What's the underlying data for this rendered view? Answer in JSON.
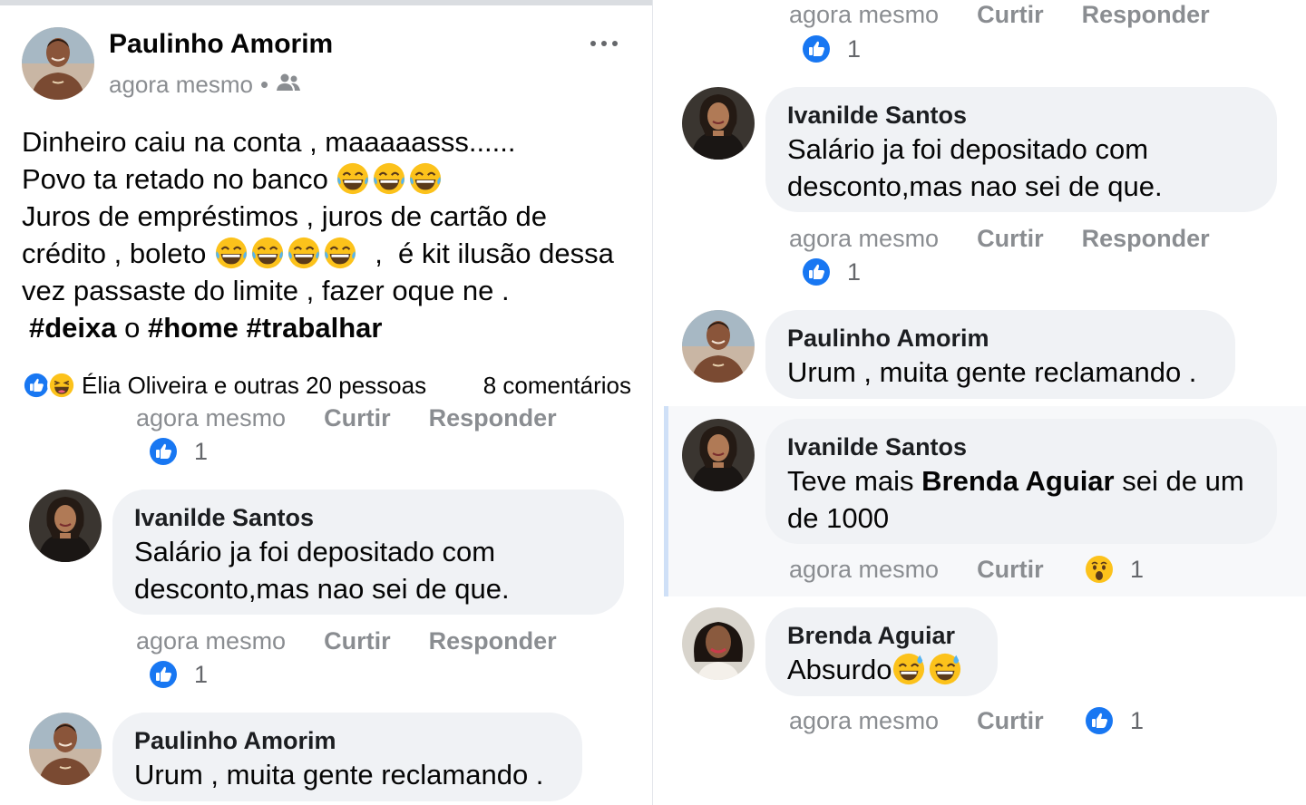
{
  "post": {
    "author": "Paulinho Amorim",
    "time": "agora mesmo",
    "separator": "•",
    "audience_icon": "friends-icon",
    "lines": [
      "Dinheiro caiu na conta , maaaaasss......",
      "Povo ta retado no banco ",
      "Juros de empréstimos , juros de cartão de",
      "crédito , boleto ",
      "  ,  é kit ilusão dessa",
      "vez passaste do limite , fazer oque ne ."
    ],
    "hashtags": {
      "h1": "#deixa",
      "mid": " o ",
      "h2": "#home",
      "space": " ",
      "h3": "#trabalhar"
    },
    "reactors": "Élia Oliveira e outras 20 pessoas",
    "comments_count": "8 comentários"
  },
  "labels": {
    "time": "agora mesmo",
    "like": "Curtir",
    "reply": "Responder"
  },
  "comments_left": [
    {
      "reactions": "1"
    },
    {
      "author": "Ivanilde Santos",
      "line1": "Salário ja foi depositado com",
      "line2": "desconto,mas nao sei de que.",
      "reactions": "1"
    },
    {
      "author": "Paulinho Amorim",
      "line1": "Urum , muita gente reclamando ."
    }
  ],
  "comments_right": [
    {
      "reactions": "1"
    },
    {
      "author": "Ivanilde Santos",
      "line1": "Salário ja foi depositado com",
      "line2": "desconto,mas nao sei de que.",
      "reactions": "1"
    },
    {
      "author": "Paulinho Amorim",
      "line1": "Urum , muita gente reclamando ."
    },
    {
      "author": "Ivanilde Santos",
      "pre": "Teve mais ",
      "mention": "Brenda Aguiar",
      "post": " sei de um",
      "line2": "de 1000",
      "reactions": "1"
    },
    {
      "author": "Brenda Aguiar",
      "text": "Absurdo",
      "reactions": "1"
    }
  ],
  "colors": {
    "like_blue": "#1877f2",
    "bubble": "#f0f2f5",
    "meta_gray": "#8a8d91",
    "emoji_yellow": "#fcc21b"
  }
}
